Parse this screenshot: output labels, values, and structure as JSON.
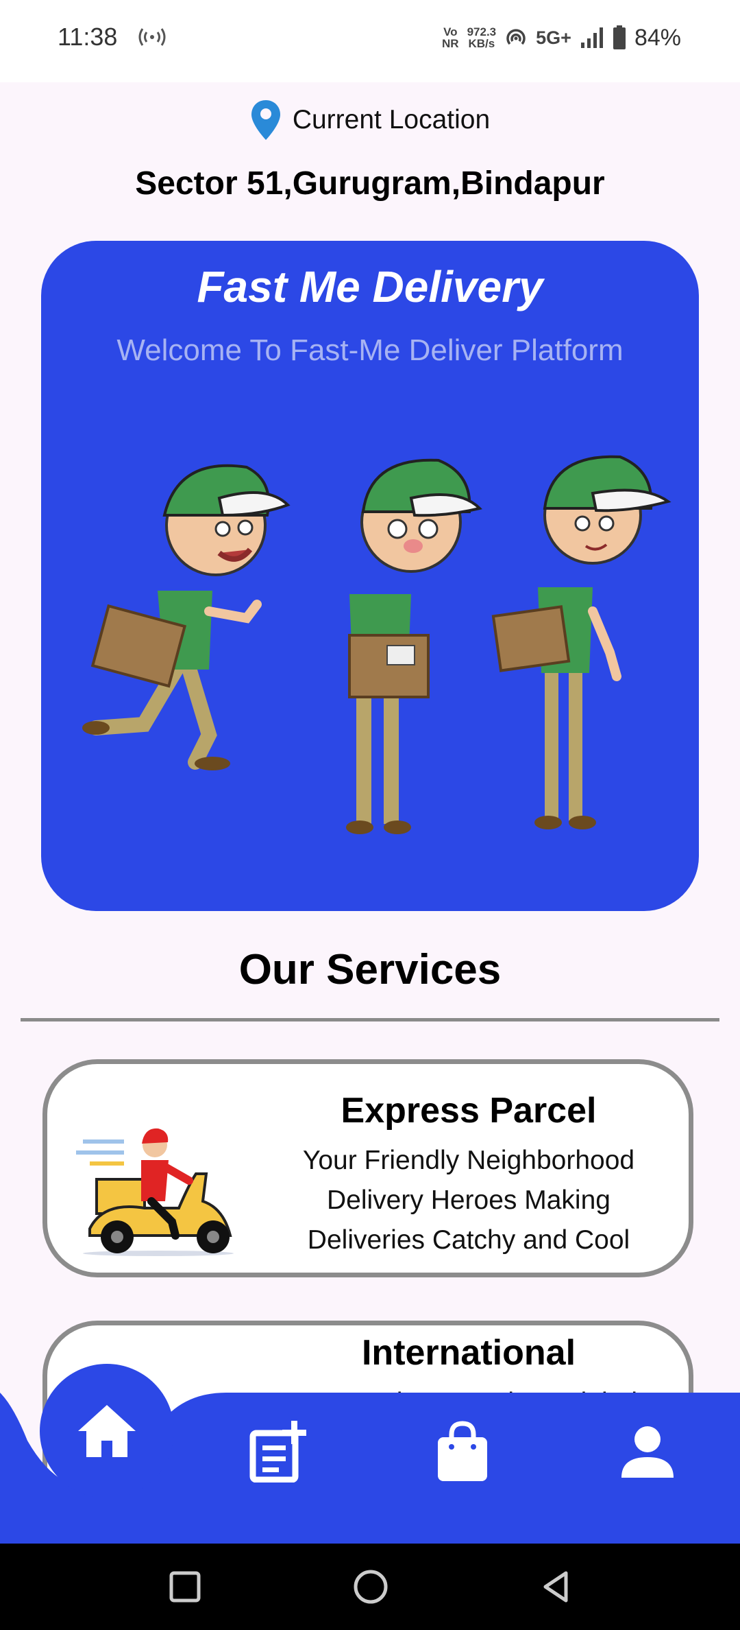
{
  "status_bar": {
    "time": "11:38",
    "volte_top": "Vo",
    "volte_bottom": "NR",
    "speed_value": "972.3",
    "speed_unit": "KB/s",
    "network": "5G+",
    "battery": "84%"
  },
  "location": {
    "label": "Current Location",
    "address": "Sector 51,Gurugram,Bindapur"
  },
  "hero": {
    "title": "Fast Me Delivery",
    "subtitle": "Welcome To Fast-Me Deliver Platform"
  },
  "services": {
    "heading": "Our Services",
    "items": [
      {
        "title": "Express Parcel",
        "description": "Your Friendly Neighborhood Delivery Heroes Making Deliveries Catchy and Cool"
      },
      {
        "title": "International",
        "description": "Fastme has an robust global"
      }
    ]
  },
  "bottom_nav": {
    "items": [
      "home-icon",
      "orders-icon",
      "bag-icon",
      "profile-icon"
    ],
    "active": "home-icon"
  },
  "colors": {
    "primary": "#2c48e6",
    "background": "#fcf5fc",
    "pin": "#2a8ad8",
    "card_border": "#8c8c8c"
  }
}
